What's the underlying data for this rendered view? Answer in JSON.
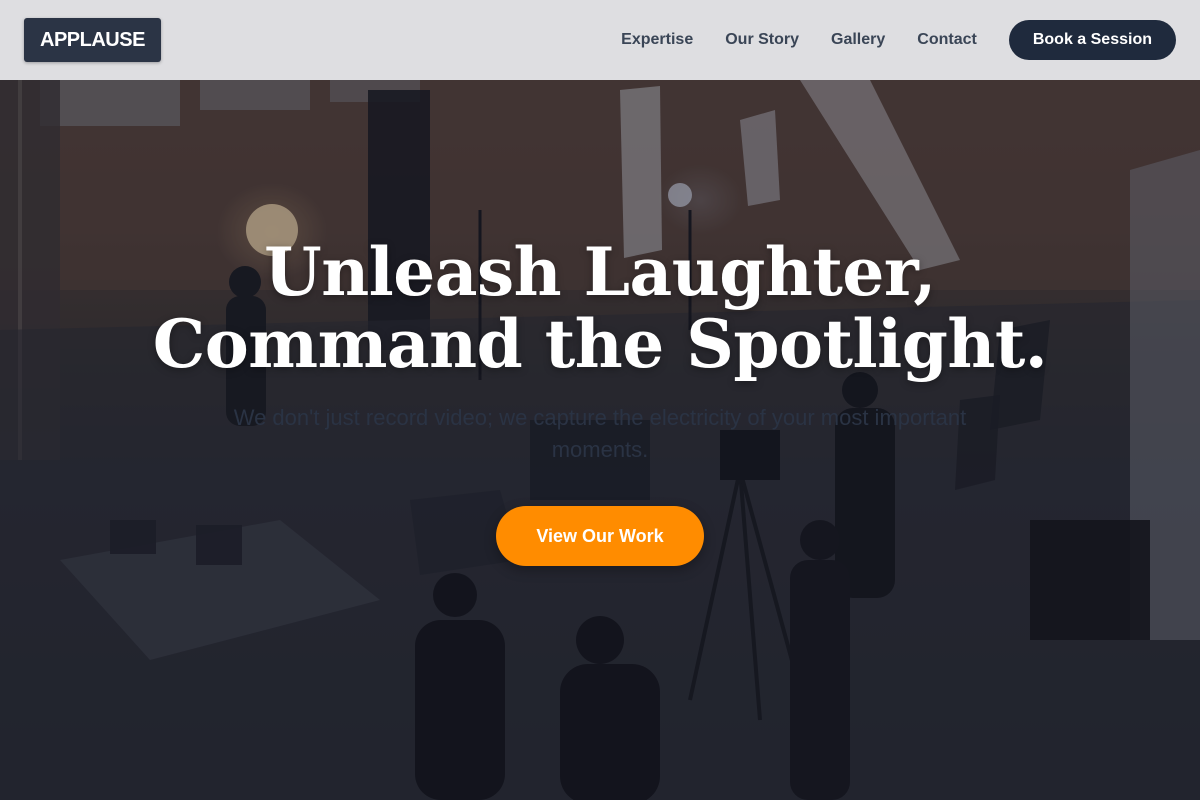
{
  "header": {
    "logo": "APPLAUSE",
    "nav": [
      {
        "label": "Expertise"
      },
      {
        "label": "Our Story"
      },
      {
        "label": "Gallery"
      },
      {
        "label": "Contact"
      }
    ],
    "cta_label": "Book a Session"
  },
  "hero": {
    "headline_line1": "Unleash Laughter,",
    "headline_line2": "Command the Spotlight.",
    "subtitle": "We don't just record video; we capture the electricity of your most important moments.",
    "cta_label": "View Our Work",
    "background_image": "film-studio-crew-photo"
  },
  "colors": {
    "accent": "#ff8c00",
    "brand_dark": "#1f2a3d",
    "header_bg": "#ecedf0"
  }
}
